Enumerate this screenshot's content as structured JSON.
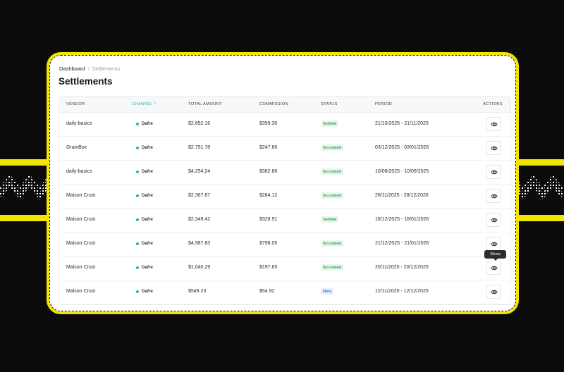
{
  "breadcrumb": {
    "root": "Dashboard",
    "separator": "/",
    "current": "Settlements"
  },
  "page_title": "Settlements",
  "table": {
    "headers": {
      "vendor": "VENDOR",
      "channel": "CHANNEL",
      "total_amount": "TOTAL AMOUNT",
      "commission": "COMMISSION",
      "status": "STATUS",
      "period": "PERIOD",
      "actions": "ACTIONS"
    },
    "sort_indicator": "^",
    "rows": [
      {
        "vendor": "daily-basics",
        "channel": "Dafre",
        "total": "$2,852.16",
        "commission": "$399.30",
        "status": "Settled",
        "status_type": "settled",
        "period": "21/10/2025 - 21/11/2025"
      },
      {
        "vendor": "GrainBox",
        "channel": "Dafre",
        "total": "$2,751.78",
        "commission": "$247.66",
        "status": "Accepted",
        "status_type": "accepted",
        "period": "03/12/2025 - 03/01/2026"
      },
      {
        "vendor": "daily-basics",
        "channel": "Dafre",
        "total": "$4,254.24",
        "commission": "$382.88",
        "status": "Accepted",
        "status_type": "accepted",
        "period": "10/08/2025 - 10/09/2025"
      },
      {
        "vendor": "Maison Crust",
        "channel": "Dafre",
        "total": "$2,367.67",
        "commission": "$284.12",
        "status": "Accepted",
        "status_type": "accepted",
        "period": "28/11/2025 - 28/12/2026"
      },
      {
        "vendor": "Maison Crust",
        "channel": "Dafre",
        "total": "$2,349.42",
        "commission": "$328.91",
        "status": "Settled",
        "status_type": "settled",
        "period": "18/12/2025 - 18/01/2026"
      },
      {
        "vendor": "Maison Crust",
        "channel": "Dafre",
        "total": "$4,987.83",
        "commission": "$798.05",
        "status": "Accepted",
        "status_type": "accepted",
        "period": "21/12/2025 - 21/01/2026"
      },
      {
        "vendor": "Maison Crust",
        "channel": "Dafre",
        "total": "$1,040.29",
        "commission": "$197.65",
        "status": "Accepted",
        "status_type": "accepted",
        "period": "20/11/2025 - 20/12/2025"
      },
      {
        "vendor": "Maison Crust",
        "channel": "Dafre",
        "total": "$549.23",
        "commission": "$54.92",
        "status": "New",
        "status_type": "new",
        "period": "12/11/2025 - 12/12/2025"
      }
    ],
    "action_icon": "eye-icon",
    "tooltip": "Show"
  },
  "colors": {
    "accent": "#2fb59a",
    "frame": "#f2e600",
    "background": "#0b0b0b"
  }
}
